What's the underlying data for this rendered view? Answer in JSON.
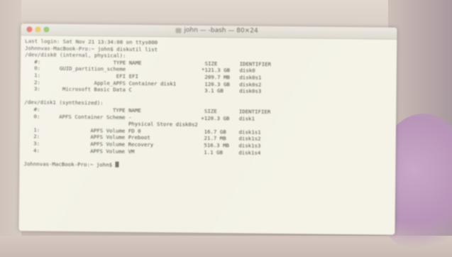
{
  "window": {
    "title": "john — -bash — 80×24"
  },
  "terminal": {
    "lines": [
      "Last login: Sat Nov 21 13:34:08 on ttys000",
      "Johnnvas-MacBook-Pro:~ john$ diskutil list",
      "/dev/disk0 (internal, physical):",
      "   #:                       TYPE NAME                    SIZE       IDENTIFIER",
      "   0:      GUID_partition_scheme                        *121.3 GB   disk0",
      "   1:                        EFI EFI                     209.7 MB   disk0s1",
      "   2:                 Apple_APFS Container disk1         120.3 GB   disk0s2",
      "   3:       Microsoft Basic Data C                       3.1 GB     disk0s3",
      "",
      "/dev/disk1 (synthesized):",
      "   #:                       TYPE NAME                    SIZE       IDENTIFIER",
      "   0:      APFS Container Scheme -                      +120.3 GB   disk1",
      "                                 Physical Store disk0s2",
      "   1:                APFS Volume FD 0                    16.7 GB    disk1s1",
      "   2:                APFS Volume Preboot                 21.7 MB    disk1s2",
      "   3:                APFS Volume Recovery                516.3 MB   disk1s3",
      "   4:                APFS Volume VM                      1.1 GB     disk1s4",
      "",
      "Johnnvas-MacBook-Pro:~ john$ "
    ]
  },
  "colors": {
    "terminal_bg": "#f4f2e6",
    "text": "#4f4c45",
    "close": "#e26b63",
    "minimize": "#e7c35b",
    "maximize": "#8fc26a"
  },
  "icons": [
    "close-icon",
    "minimize-icon",
    "maximize-icon",
    "folder-icon",
    "cursor"
  ]
}
